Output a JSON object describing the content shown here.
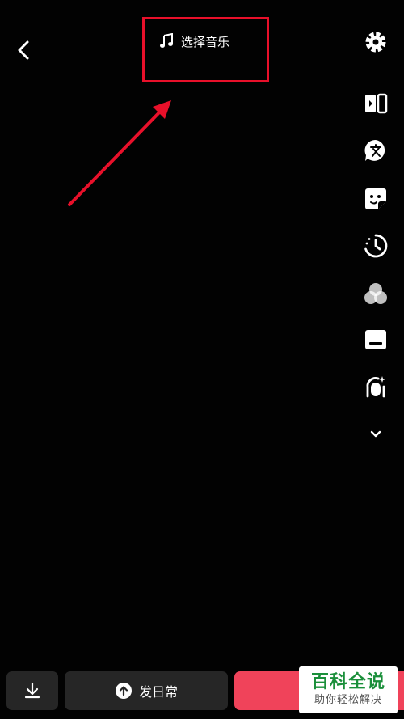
{
  "header": {
    "music_label": "选择音乐"
  },
  "right_rail": {
    "icons": [
      "settings-icon",
      "switch-camera-icon",
      "text-icon",
      "sticker-icon",
      "timer-icon",
      "filter-icon",
      "subtitle-icon",
      "beauty-icon",
      "expand-more-icon"
    ]
  },
  "bottom_bar": {
    "daily_label": "发日常"
  },
  "watermark": {
    "main": "百科全说",
    "sub": "助你轻松解决"
  },
  "colors": {
    "background": "#020202",
    "annotation": "#e8102a",
    "primary": "#f0435a",
    "button_bg": "#262626",
    "watermark_green": "#1a8f3a"
  }
}
